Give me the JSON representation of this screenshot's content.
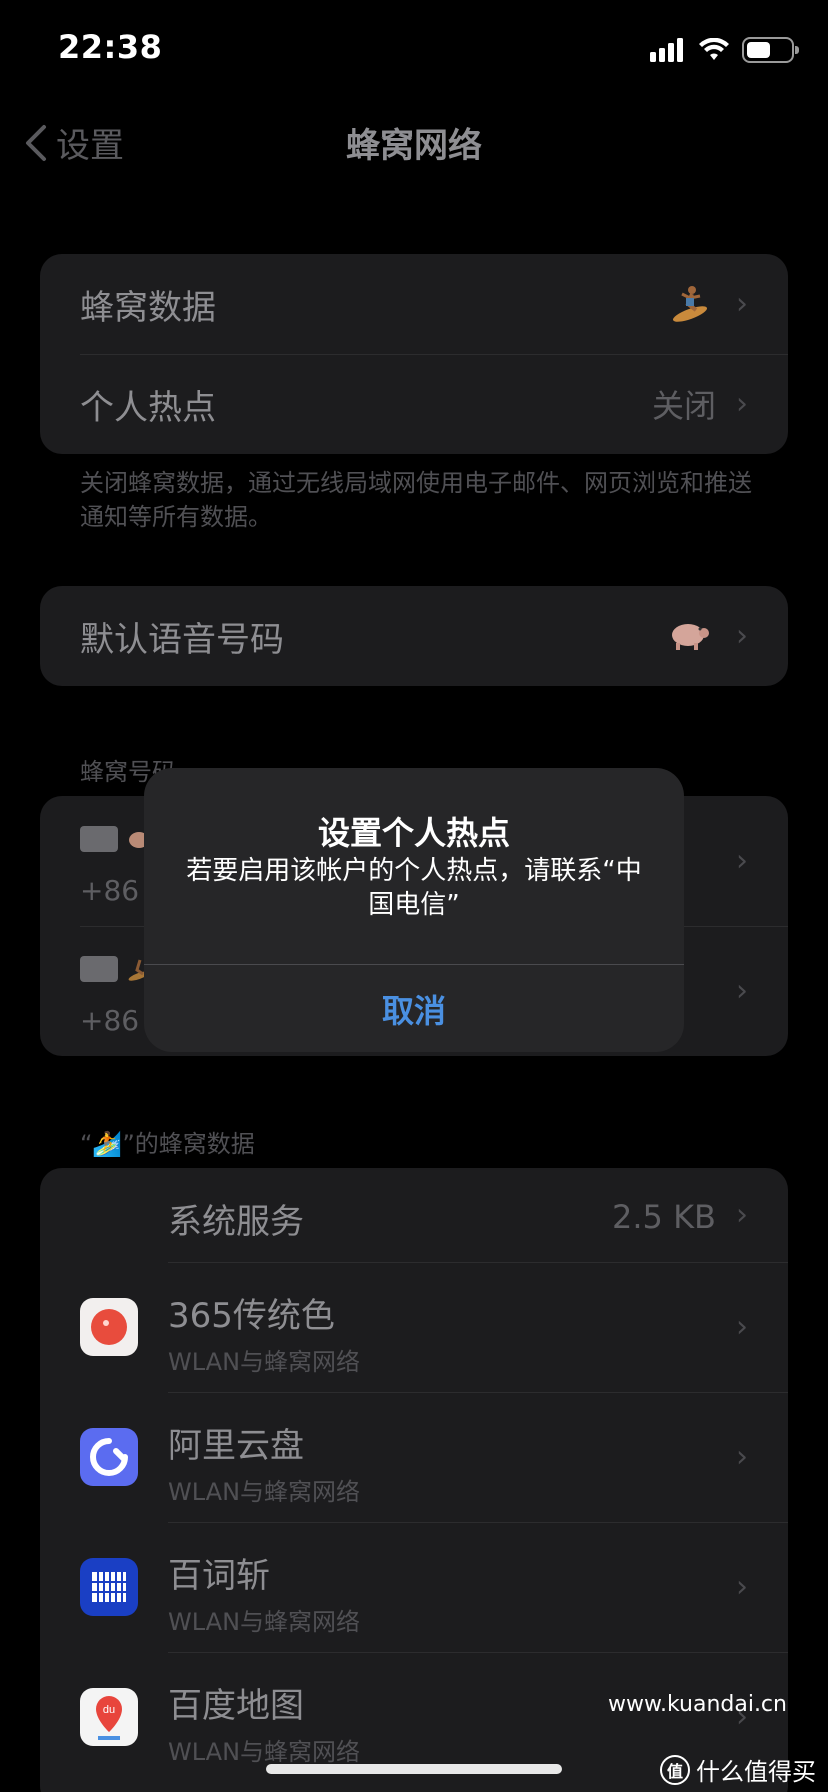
{
  "status_bar": {
    "time": "22:38",
    "battery_level": 0.55
  },
  "nav": {
    "back_label": "设置",
    "title": "蜂窝网络"
  },
  "group1": {
    "rows": [
      {
        "label": "蜂窝数据",
        "value": "",
        "icon": "surfer-emoji-icon"
      },
      {
        "label": "个人热点",
        "value": "关闭"
      }
    ],
    "footnote": "关闭蜂窝数据，通过无线局域网使用电子邮件、网页浏览和推送通知等所有数据。"
  },
  "group2": {
    "rows": [
      {
        "label": "默认语音号码",
        "icon": "pig-emoji-icon"
      }
    ]
  },
  "numbers_section": {
    "header": "蜂窝号码",
    "sims": [
      {
        "number": "+86",
        "icon": "pig-emoji-icon"
      },
      {
        "number": "+86",
        "icon": "surfer-emoji-icon"
      }
    ]
  },
  "apps_section": {
    "header": "“🏄”的蜂窝数据",
    "rows": [
      {
        "name": "系统服务",
        "value": "2.5 KB"
      },
      {
        "name": "365传统色",
        "sub": "WLAN与蜂窝网络",
        "icon": "365-colors-app-icon",
        "color": "#e84c3d"
      },
      {
        "name": "阿里云盘",
        "sub": "WLAN与蜂窝网络",
        "icon": "aliyun-drive-app-icon",
        "color": "#5b6cf0"
      },
      {
        "name": "百词斩",
        "sub": "WLAN与蜂窝网络",
        "icon": "baicizhan-app-icon",
        "color": "#1a3fc4"
      },
      {
        "name": "百度地图",
        "sub": "WLAN与蜂窝网络",
        "icon": "baidu-map-app-icon",
        "color": "#e8453c"
      }
    ]
  },
  "alert": {
    "title": "设置个人热点",
    "message": "若要启用该帐户的个人热点，请联系“中国电信”",
    "cancel_label": "取消"
  },
  "watermark": {
    "url": "www.kuandai.cn",
    "brand": "什么值得买",
    "logo_text": "值"
  }
}
